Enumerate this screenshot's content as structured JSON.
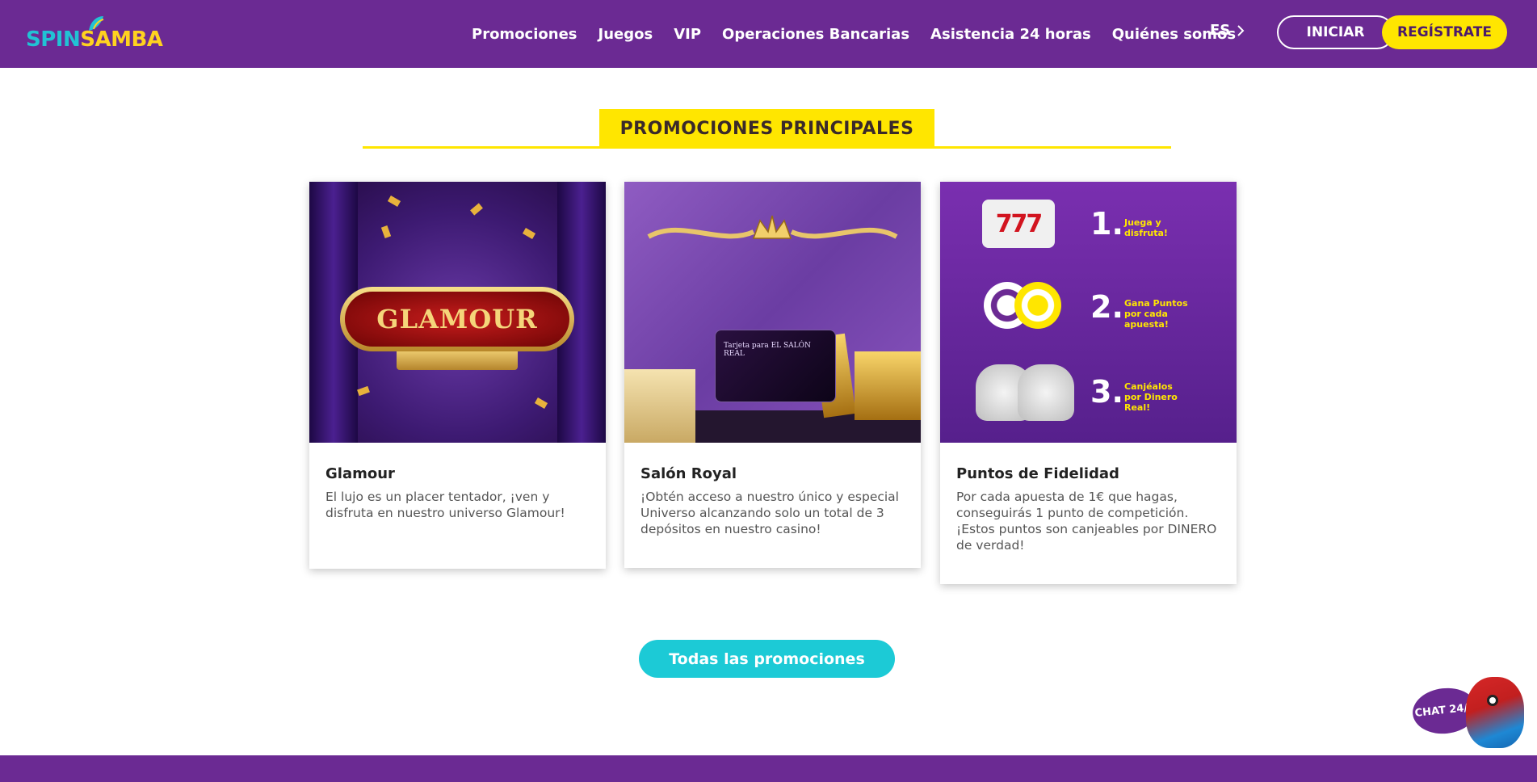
{
  "header": {
    "logo_spin": "SPIN",
    "logo_samba": "SAMBA",
    "nav": [
      "Promociones",
      "Juegos",
      "VIP",
      "Operaciones Bancarias",
      "Asistencia 24 horas",
      "Quiénes somos"
    ],
    "language": "ES",
    "login_label": "INICIAR",
    "register_label": "REGÍSTRATE"
  },
  "section": {
    "title": "PROMOCIONES PRINCIPALES"
  },
  "cards": [
    {
      "image_text": "GLAMOUR",
      "title": "Glamour",
      "description": "El lujo es un placer tentador, ¡ven y disfruta en nuestro universo Glamour!"
    },
    {
      "image_text": "Tarjeta para EL SALÓN REAL",
      "title": "Salón Royal",
      "description": "¡Obtén acceso a nuestro único y especial Universo alcanzando solo un total de 3 depósitos en nuestro casino!"
    },
    {
      "image_steps": [
        {
          "num": "1.",
          "text": "Juega y disfruta!"
        },
        {
          "num": "2.",
          "text": "Gana Puntos por cada apuesta!"
        },
        {
          "num": "3.",
          "text": "Canjéalos por Dinero Real!"
        }
      ],
      "title": "Puntos de Fidelidad",
      "description": "Por cada apuesta de 1€ que hagas, conseguirás 1 punto de competición. ¡Estos puntos son canjeables por DINERO de verdad!"
    }
  ],
  "cta_label": "Todas las promociones",
  "chat_label": "CHAT 24/7",
  "colors": {
    "brand_purple": "#6b2a93",
    "accent_yellow": "#ffe600",
    "accent_cyan": "#1ccad6"
  }
}
